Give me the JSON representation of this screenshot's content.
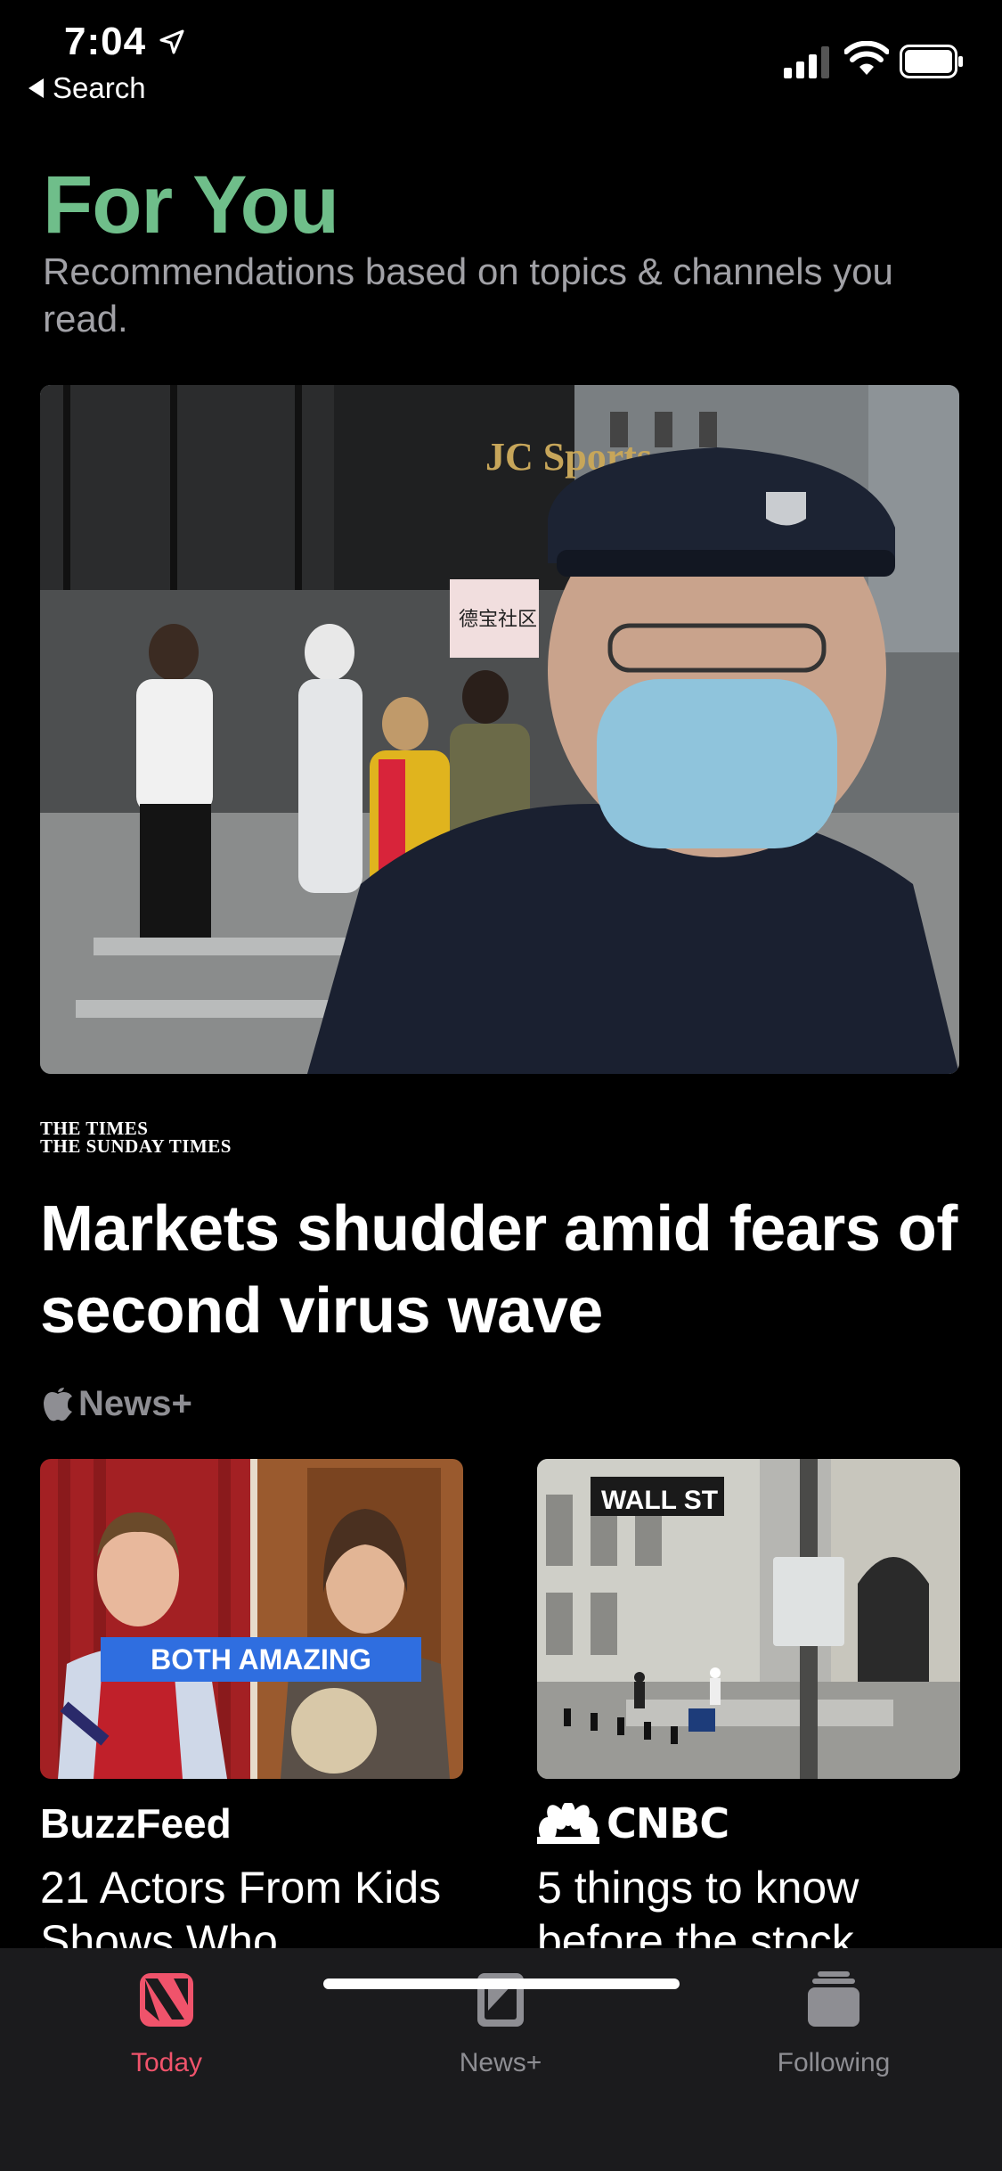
{
  "status_bar": {
    "time": "7:04",
    "back_label": "Search"
  },
  "header": {
    "title": "For You",
    "subtitle": "Recommendations based on topics & channels you read."
  },
  "hero": {
    "publisher_line1": "THE TIMES",
    "publisher_line2": "THE SUNDAY TIMES",
    "headline": "Markets shudder amid fears of second virus wave",
    "badge": "News+",
    "image_sign_text": "德宝社区",
    "image_building_text": "JC Sports"
  },
  "cards": [
    {
      "publisher": "BuzzFeed",
      "headline": "21 Actors From Kids Shows Who",
      "image_caption": "BOTH AMAZING"
    },
    {
      "publisher": "CNBC",
      "headline": "5 things to know before the stock",
      "image_sign_text": "WALL ST"
    }
  ],
  "tabs": [
    {
      "label": "Today",
      "icon": "news-logo-icon",
      "active": true
    },
    {
      "label": "News+",
      "icon": "news-plus-icon",
      "active": false
    },
    {
      "label": "Following",
      "icon": "following-icon",
      "active": false
    }
  ],
  "colors": {
    "accent_green": "#6fbe8a",
    "accent_red": "#f0536b",
    "background": "#000000"
  }
}
